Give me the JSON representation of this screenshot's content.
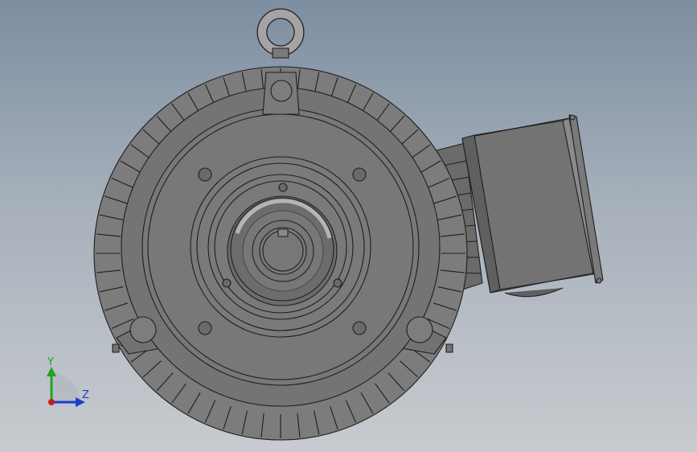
{
  "view": {
    "background_top": "#7d8ea1",
    "background_bottom": "#c8cbcf",
    "body_color": "#6f6f6f",
    "edge_color": "#1e1e1e"
  },
  "model": {
    "components": [
      "eye-bolt",
      "motor-housing",
      "cooling-fins",
      "end-flange",
      "bearing-cap",
      "shaft",
      "keyway",
      "terminal-box",
      "mounting-feet"
    ]
  },
  "triad": {
    "y_label": "Y",
    "z_label": "Z",
    "y_color": "#1fa51f",
    "z_color": "#1a3fd0",
    "origin_color": "#c81e1e"
  }
}
